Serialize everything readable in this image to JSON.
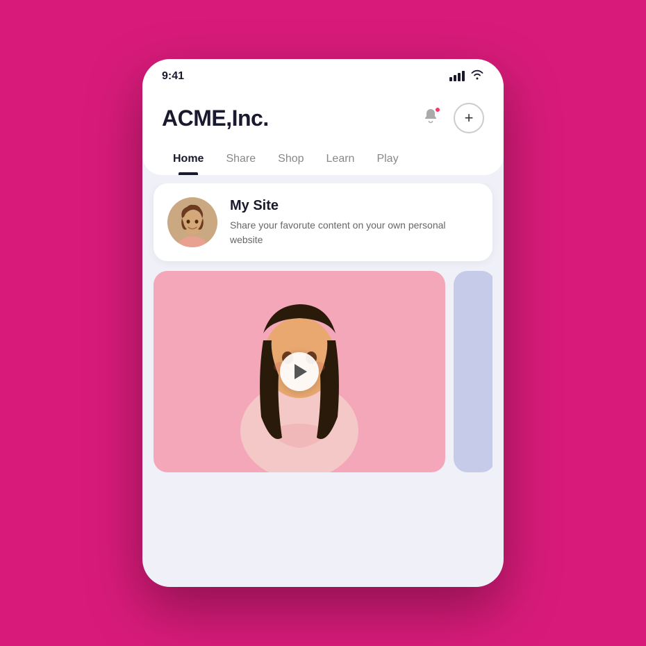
{
  "background_color": "#D81B7A",
  "status_bar": {
    "time": "9:41",
    "signal_label": "signal",
    "wifi_label": "wifi"
  },
  "header": {
    "title": "ACME,Inc.",
    "notification_label": "notifications",
    "add_label": "add"
  },
  "nav": {
    "tabs": [
      {
        "label": "Home",
        "active": true
      },
      {
        "label": "Share",
        "active": false
      },
      {
        "label": "Shop",
        "active": false
      },
      {
        "label": "Learn",
        "active": false
      },
      {
        "label": "Play",
        "active": false
      }
    ]
  },
  "my_site": {
    "title": "My Site",
    "description": "Share your favorute content on your own personal website"
  },
  "video": {
    "play_label": "play video"
  }
}
